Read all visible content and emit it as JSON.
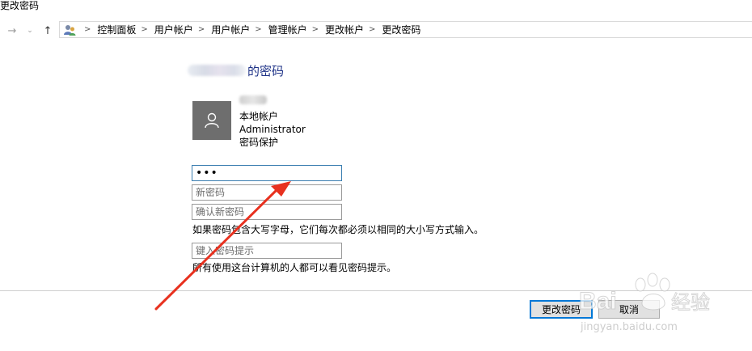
{
  "window": {
    "title": "更改密码"
  },
  "nav": {
    "back_glyph": "→",
    "recent_glyph": "⌄",
    "up_glyph": "↑"
  },
  "address_bar": {
    "icon": "control-panel-users-icon",
    "crumbs": [
      "控制面板",
      "用户帐户",
      "用户帐户",
      "管理帐户",
      "更改帐户",
      "更改密码"
    ]
  },
  "main": {
    "heading_suffix": "的密码",
    "account": {
      "type": "本地帐户",
      "role": "Administrator",
      "protection": "密码保护"
    },
    "fields": {
      "current_password_value": "•••",
      "new_password_placeholder": "新密码",
      "confirm_password_placeholder": "确认新密码",
      "hint_placeholder": "键入密码提示"
    },
    "case_note": "如果密码包含大写字母，它们每次都必须以相同的大小写方式输入。",
    "hint_note": "所有使用这台计算机的人都可以看见密码提示。"
  },
  "buttons": {
    "change_password": "更改密码",
    "cancel": "取消"
  },
  "annotation": {
    "arrow_color": "#e8311f"
  },
  "colors": {
    "heading": "#1e3287",
    "focus_border": "#3c7fb1",
    "default_button_border": "#0078d7"
  },
  "watermark": {
    "brand": "Baidu经验",
    "url": "jingyan.baidu.com"
  }
}
